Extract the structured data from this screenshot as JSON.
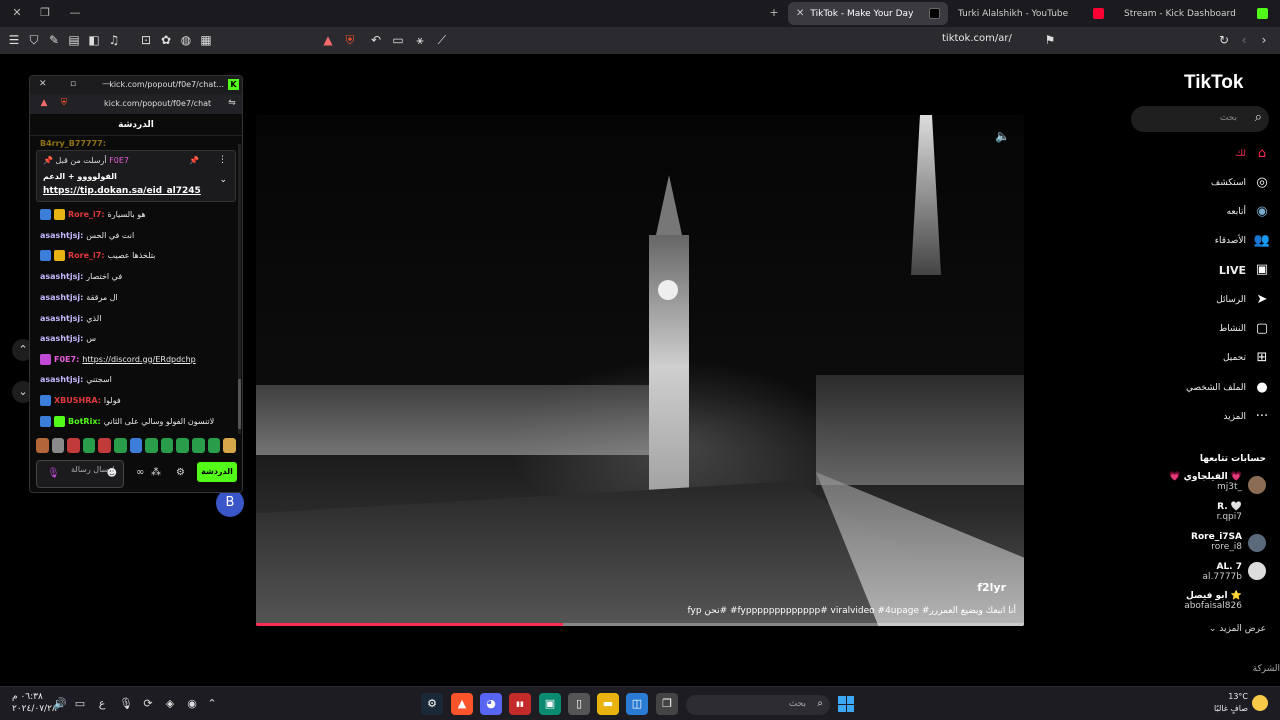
{
  "browser": {
    "tabs": [
      {
        "title": "TikTok - Make Your Day",
        "active": true
      },
      {
        "title": "Turki Alalshikh - YouTube",
        "active": false
      },
      {
        "title": "Stream - Kick Dashboard",
        "active": false
      }
    ],
    "new_tab": "+",
    "url": "tiktok.com/ar/"
  },
  "video": {
    "handle": "f2lyr",
    "caption": "أنا اتبعك ويضيع العمررر# fyppppppppppppp# viralvideo #4upage# #نحن fyp",
    "progress": 0.4,
    "more": "···"
  },
  "tiktok": {
    "logo": "TikTok",
    "search_placeholder": "بحث",
    "nav": [
      {
        "label": "لك",
        "icon": "home-icon",
        "glyph": "⌂"
      },
      {
        "label": "استكشف",
        "icon": "compass-icon",
        "glyph": "◎"
      },
      {
        "label": "أتابعه",
        "icon": "following-avatar-icon",
        "glyph": "◉"
      },
      {
        "label": "الأصدقاء",
        "icon": "friends-icon",
        "glyph": "👥"
      },
      {
        "label": "LIVE",
        "icon": "live-icon",
        "glyph": "▣"
      },
      {
        "label": "الرسائل",
        "icon": "send-icon",
        "glyph": "➤"
      },
      {
        "label": "النشاط",
        "icon": "activity-icon",
        "glyph": "▢"
      },
      {
        "label": "تحميل",
        "icon": "upload-icon",
        "glyph": "⊞"
      },
      {
        "label": "الملف الشخصي",
        "icon": "profile-icon",
        "glyph": "●"
      },
      {
        "label": "المزيد",
        "icon": "more-icon",
        "glyph": "···"
      }
    ],
    "following_title": "حسابات تتابعها",
    "following": [
      {
        "name": "💗 الفيلجاوي 💗",
        "user": "mj3t_"
      },
      {
        "name": "R. 🤍",
        "user": "r.qpi7"
      },
      {
        "name": "Rore_i7SA",
        "user": "rore_i8"
      },
      {
        "name": "AL. 7",
        "user": "al.7777b"
      },
      {
        "name": "ابو فيصل ⭐",
        "user": "abofaisal826"
      }
    ],
    "see_more": "عرض المزيد",
    "company": "الشركة"
  },
  "chat_window": {
    "title": "kick.com/popout/f0e7/chat...",
    "url": "kick.com/popout/f0e7/chat",
    "header": "الدردشة",
    "partial_user": "B4rry_B77777:",
    "pinned": {
      "by_label": "أرسلت من قبل",
      "by_user": "F0E7",
      "line1": "الفولوووو + الدعم",
      "link": "https://tip.dokan.sa/eid_al7245"
    },
    "messages": [
      {
        "user": "Rore_i7:",
        "text": "هو بالسيارة",
        "color": "#e0393e",
        "badges": [
          "#3b7dd8",
          "#e7b416"
        ]
      },
      {
        "user": "asashtjsj:",
        "text": "انت في الحس",
        "color": "#c7b8ff",
        "badges": []
      },
      {
        "user": "Rore_i7:",
        "text": "بتلخذها عصيب",
        "color": "#e0393e",
        "badges": [
          "#3b7dd8",
          "#e7b416"
        ]
      },
      {
        "user": "asashtjsj:",
        "text": "في اختصار",
        "color": "#c7b8ff",
        "badges": []
      },
      {
        "user": "asashtjsj:",
        "text": "ال مرققة",
        "color": "#c7b8ff",
        "badges": []
      },
      {
        "user": "asashtjsj:",
        "text": "الذي",
        "color": "#c7b8ff",
        "badges": []
      },
      {
        "user": "asashtjsj:",
        "text": "س",
        "color": "#c7b8ff",
        "badges": []
      },
      {
        "user": "F0E7:",
        "text": "https://discord.gg/ERdpdchp",
        "color": "#e75fd6",
        "badges": [
          "#c04ad6"
        ],
        "link": true
      },
      {
        "user": "asashtjsj:",
        "text": "اسجتني",
        "color": "#c7b8ff",
        "badges": []
      },
      {
        "user": "XBUSHRA:",
        "text": "فولوا",
        "color": "#e0393e",
        "badges": [
          "#3b7dd8"
        ]
      },
      {
        "user": "BotRix:",
        "text": "لاتنسون الفولو وسالي على الثاني",
        "color": "#53fc18",
        "badges": [
          "#3b7dd8",
          "#53fc18"
        ]
      }
    ],
    "input_placeholder": "إرسال رسالة",
    "send_label": "الدردشة",
    "emote_colors": [
      "#b2663a",
      "#8a8a8a",
      "#c23b3b",
      "#2a9d4b",
      "#c23b3b",
      "#2a9d4b",
      "#3b7dd8",
      "#2a9d4b",
      "#2a9d4b",
      "#2a9d4b",
      "#2a9d4b",
      "#2a9d4b",
      "#d6a74a"
    ]
  },
  "side_bubble": "B",
  "taskbar": {
    "time": "٠٦:٣٨ م",
    "date": "٢٠٢٤/٠٧/٢٨",
    "lang": "ع",
    "search_placeholder": "بحث",
    "weather_temp": "13°C",
    "weather_desc": "صافٍ غالبًا"
  }
}
